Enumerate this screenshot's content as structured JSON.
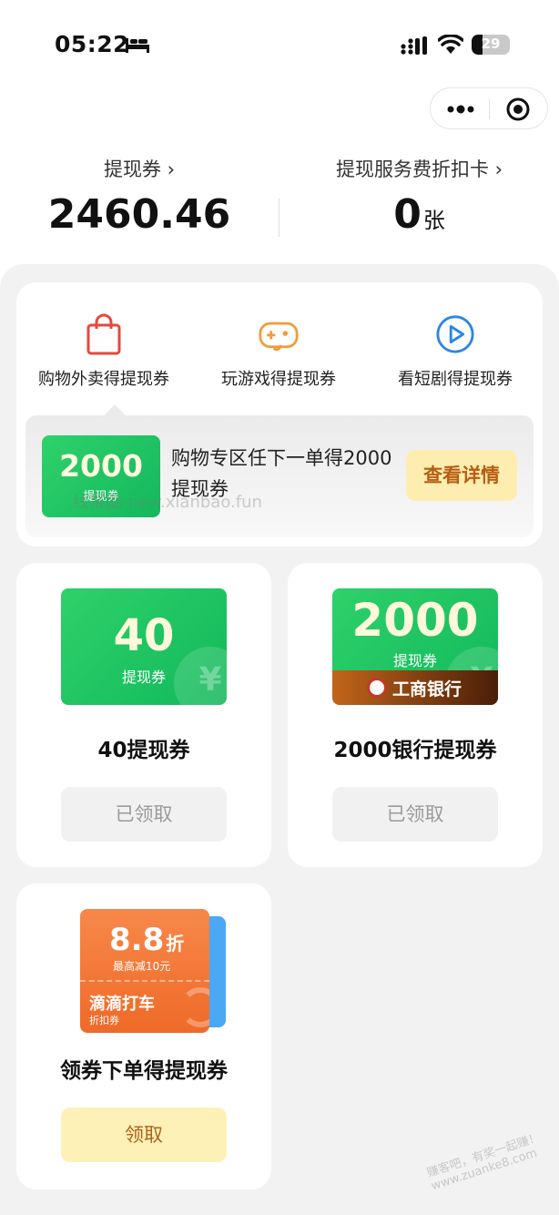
{
  "status_bar": {
    "time": "05:22",
    "battery": "29",
    "battery_level": 29
  },
  "summary": {
    "left_label": "提现券 ›",
    "left_value": "2460.46",
    "right_label": "提现服务费折扣卡 ›",
    "right_value": "0",
    "right_unit": "张"
  },
  "tabs": [
    {
      "label": "购物外卖得提现券",
      "icon": "shopping-bag-icon",
      "color": "#e5483f"
    },
    {
      "label": "玩游戏得提现券",
      "icon": "gamepad-icon",
      "color": "#f29b38"
    },
    {
      "label": "看短剧得提现券",
      "icon": "play-circle-icon",
      "color": "#2b86e4"
    }
  ],
  "promo": {
    "coupon_amount": "2000",
    "coupon_label": "提现券",
    "text": "购物专区任下一单得2000提现券",
    "button": "查看详情"
  },
  "coupons": [
    {
      "amount": "40",
      "label": "提现券",
      "title": "40提现券",
      "button": "已领取"
    },
    {
      "amount": "2000",
      "label": "提现券",
      "bank": "工商银行",
      "title": "2000银行提现券",
      "button": "已领取"
    },
    {
      "rate": "8.8",
      "rate_unit": "折",
      "max": "最高减10元",
      "brand": "滴滴打车",
      "kind": "折扣券",
      "title": "领券下单得提现券",
      "button": "领取"
    }
  ],
  "watermarks": [
    "线报酷-new.xianbao.fun",
    "赚客吧，有奖一起赚！ www.zuanke8.com"
  ],
  "colors": {
    "green": "#1cc463",
    "orange": "#f07a38",
    "claim_bg": "#fdf1b8",
    "claim_text": "#b0611a"
  }
}
